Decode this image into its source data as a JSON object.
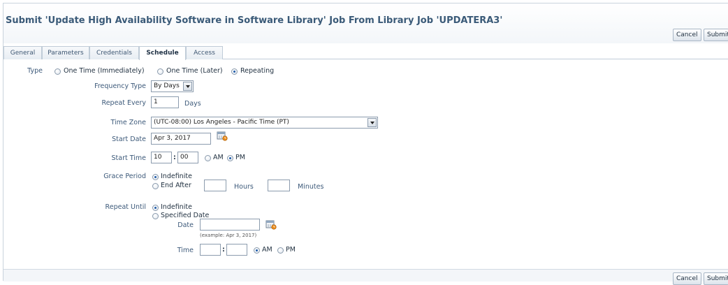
{
  "page_title": "Submit 'Update High Availability Software in Software Library' Job From Library Job 'UPDATERA3'",
  "buttons": {
    "cancel": "Cancel",
    "submit": "Submit"
  },
  "tabs": [
    {
      "label": "General"
    },
    {
      "label": "Parameters"
    },
    {
      "label": "Credentials"
    },
    {
      "label": "Schedule",
      "active": true
    },
    {
      "label": "Access"
    }
  ],
  "schedule": {
    "type_label": "Type",
    "type_options": [
      "One Time (Immediately)",
      "One Time (Later)",
      "Repeating"
    ],
    "type_selected": "Repeating",
    "frequency_type_label": "Frequency Type",
    "frequency_type_value": "By Days",
    "repeat_every_label": "Repeat Every",
    "repeat_every_value": "1",
    "repeat_every_unit": "Days",
    "time_zone_label": "Time Zone",
    "time_zone_value": "(UTC-08:00) Los Angeles - Pacific Time (PT)",
    "start_date_label": "Start Date",
    "start_date_value": "Apr 3, 2017",
    "start_time_label": "Start Time",
    "start_time_hour": "10",
    "start_time_minute": "00",
    "am_label": "AM",
    "pm_label": "PM",
    "start_time_period": "PM",
    "grace_period_label": "Grace Period",
    "grace_indefinite": "Indefinite",
    "grace_end_after": "End After",
    "grace_selected": "Indefinite",
    "hours_label": "Hours",
    "minutes_label": "Minutes",
    "repeat_until_label": "Repeat Until",
    "repeat_until_indefinite": "Indefinite",
    "repeat_until_specified": "Specified Date",
    "repeat_until_selected": "Indefinite",
    "date_label": "Date",
    "date_example": "(example: Apr 3, 2017)",
    "time_label": "Time",
    "until_time_period": "AM",
    "colon": ":"
  },
  "icons": {
    "calendar": "calendar-icon"
  },
  "colors": {
    "title": "#3a5a78",
    "label": "#3d5a7a",
    "radio_selected": "#1e5aa8"
  }
}
